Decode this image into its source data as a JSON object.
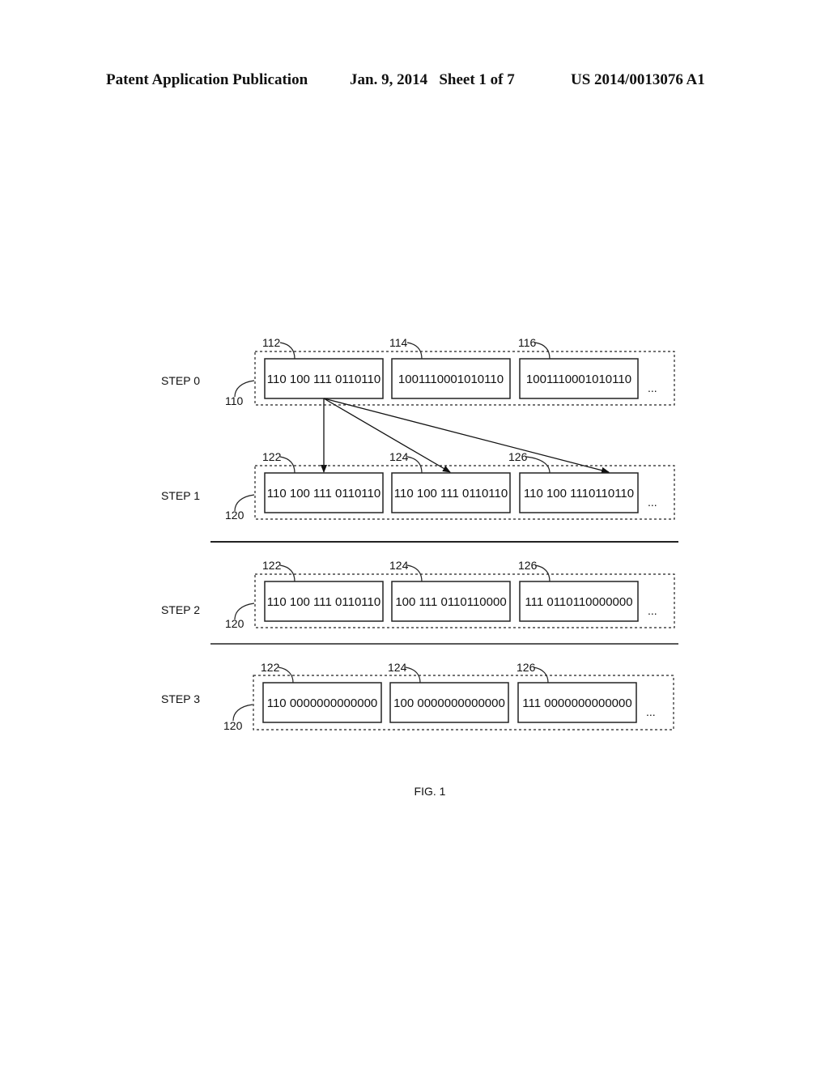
{
  "header": {
    "publication": "Patent Application Publication",
    "date_sheet": "Jan. 9, 2014   Sheet 1 of 7",
    "number": "US 2014/0013076 A1"
  },
  "figure": {
    "caption": "FIG. 1",
    "ellipsis": "...",
    "steps": [
      {
        "label": "STEP 0",
        "group_ref": "110",
        "cells": [
          {
            "ref": "112",
            "value": "110 100 111 0110110"
          },
          {
            "ref": "114",
            "value": "1001110001010110"
          },
          {
            "ref": "116",
            "value": "1001110001010110"
          }
        ]
      },
      {
        "label": "STEP 1",
        "group_ref": "120",
        "cells": [
          {
            "ref": "122",
            "value": "110 100 111 0110110"
          },
          {
            "ref": "124",
            "value": "110 100 111 0110110"
          },
          {
            "ref": "126",
            "value": "110 100 1110110110"
          }
        ]
      },
      {
        "label": "STEP 2",
        "group_ref": "120",
        "cells": [
          {
            "ref": "122",
            "value": "110 100 111 0110110"
          },
          {
            "ref": "124",
            "value": "100 111 0110110000"
          },
          {
            "ref": "126",
            "value": "111 0110110000000"
          }
        ]
      },
      {
        "label": "STEP 3",
        "group_ref": "120",
        "cells": [
          {
            "ref": "122",
            "value": "110 0000000000000"
          },
          {
            "ref": "124",
            "value": "100 0000000000000"
          },
          {
            "ref": "126",
            "value": "111 0000000000000"
          }
        ]
      }
    ]
  }
}
